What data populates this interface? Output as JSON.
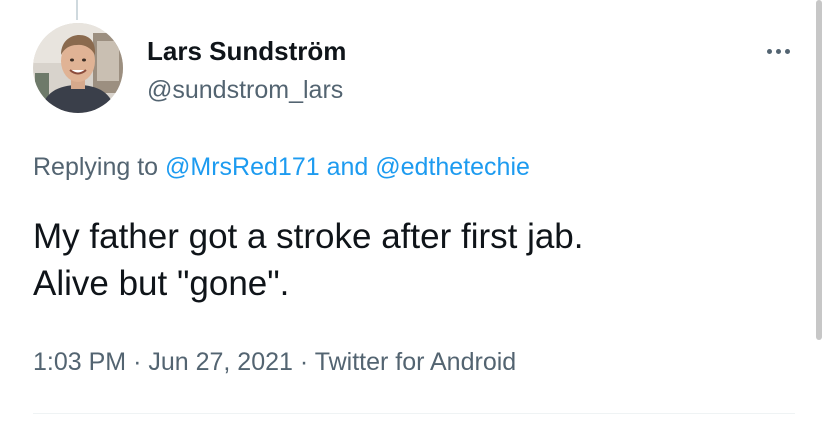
{
  "author": {
    "name": "Lars Sundström",
    "handle": "@sundstrom_lars"
  },
  "more_icon": "more-horizontal-icon",
  "reply_context": {
    "prefix": "Replying to",
    "mention_1": "@MrsRed171",
    "conjunction": "and",
    "mention_2": "@edthetechie"
  },
  "tweet": {
    "line_1": "My father got a stroke after first jab.",
    "line_2": "Alive but \"gone\"."
  },
  "metadata": {
    "time": "1:03 PM",
    "separator_1": "·",
    "date": "Jun 27, 2021",
    "separator_2": "·",
    "source": "Twitter for Android"
  },
  "colors": {
    "accent": "#1d9bf0",
    "primary_text": "#0f1419",
    "secondary_text": "#536471"
  }
}
